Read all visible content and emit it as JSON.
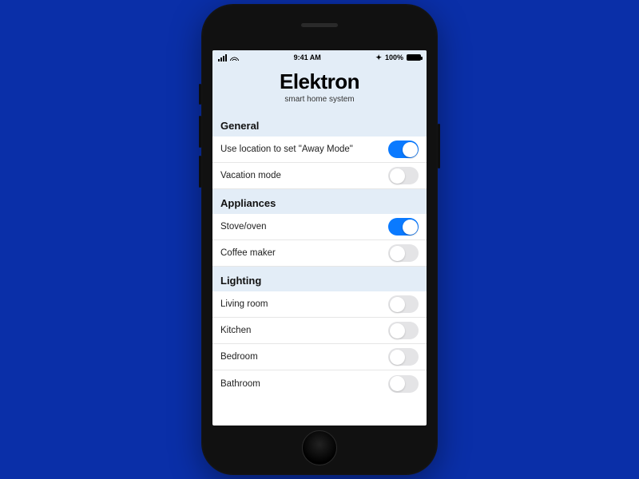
{
  "status": {
    "time": "9:41 AM",
    "battery_pct": "100%",
    "bluetooth_icon": "bluetooth",
    "signal_icon": "signal",
    "wifi_icon": "wifi"
  },
  "hero": {
    "title": "Elektron",
    "subtitle": "smart home system"
  },
  "sections": {
    "general": {
      "header": "General",
      "items": [
        {
          "label": "Use location to set \"Away Mode\"",
          "on": true
        },
        {
          "label": "Vacation mode",
          "on": false
        }
      ]
    },
    "appliances": {
      "header": "Appliances",
      "items": [
        {
          "label": "Stove/oven",
          "on": true
        },
        {
          "label": "Coffee maker",
          "on": false
        }
      ]
    },
    "lighting": {
      "header": "Lighting",
      "items": [
        {
          "label": "Living room",
          "on": false
        },
        {
          "label": "Kitchen",
          "on": false
        },
        {
          "label": "Bedroom",
          "on": false
        },
        {
          "label": "Bathroom",
          "on": false
        }
      ]
    }
  }
}
